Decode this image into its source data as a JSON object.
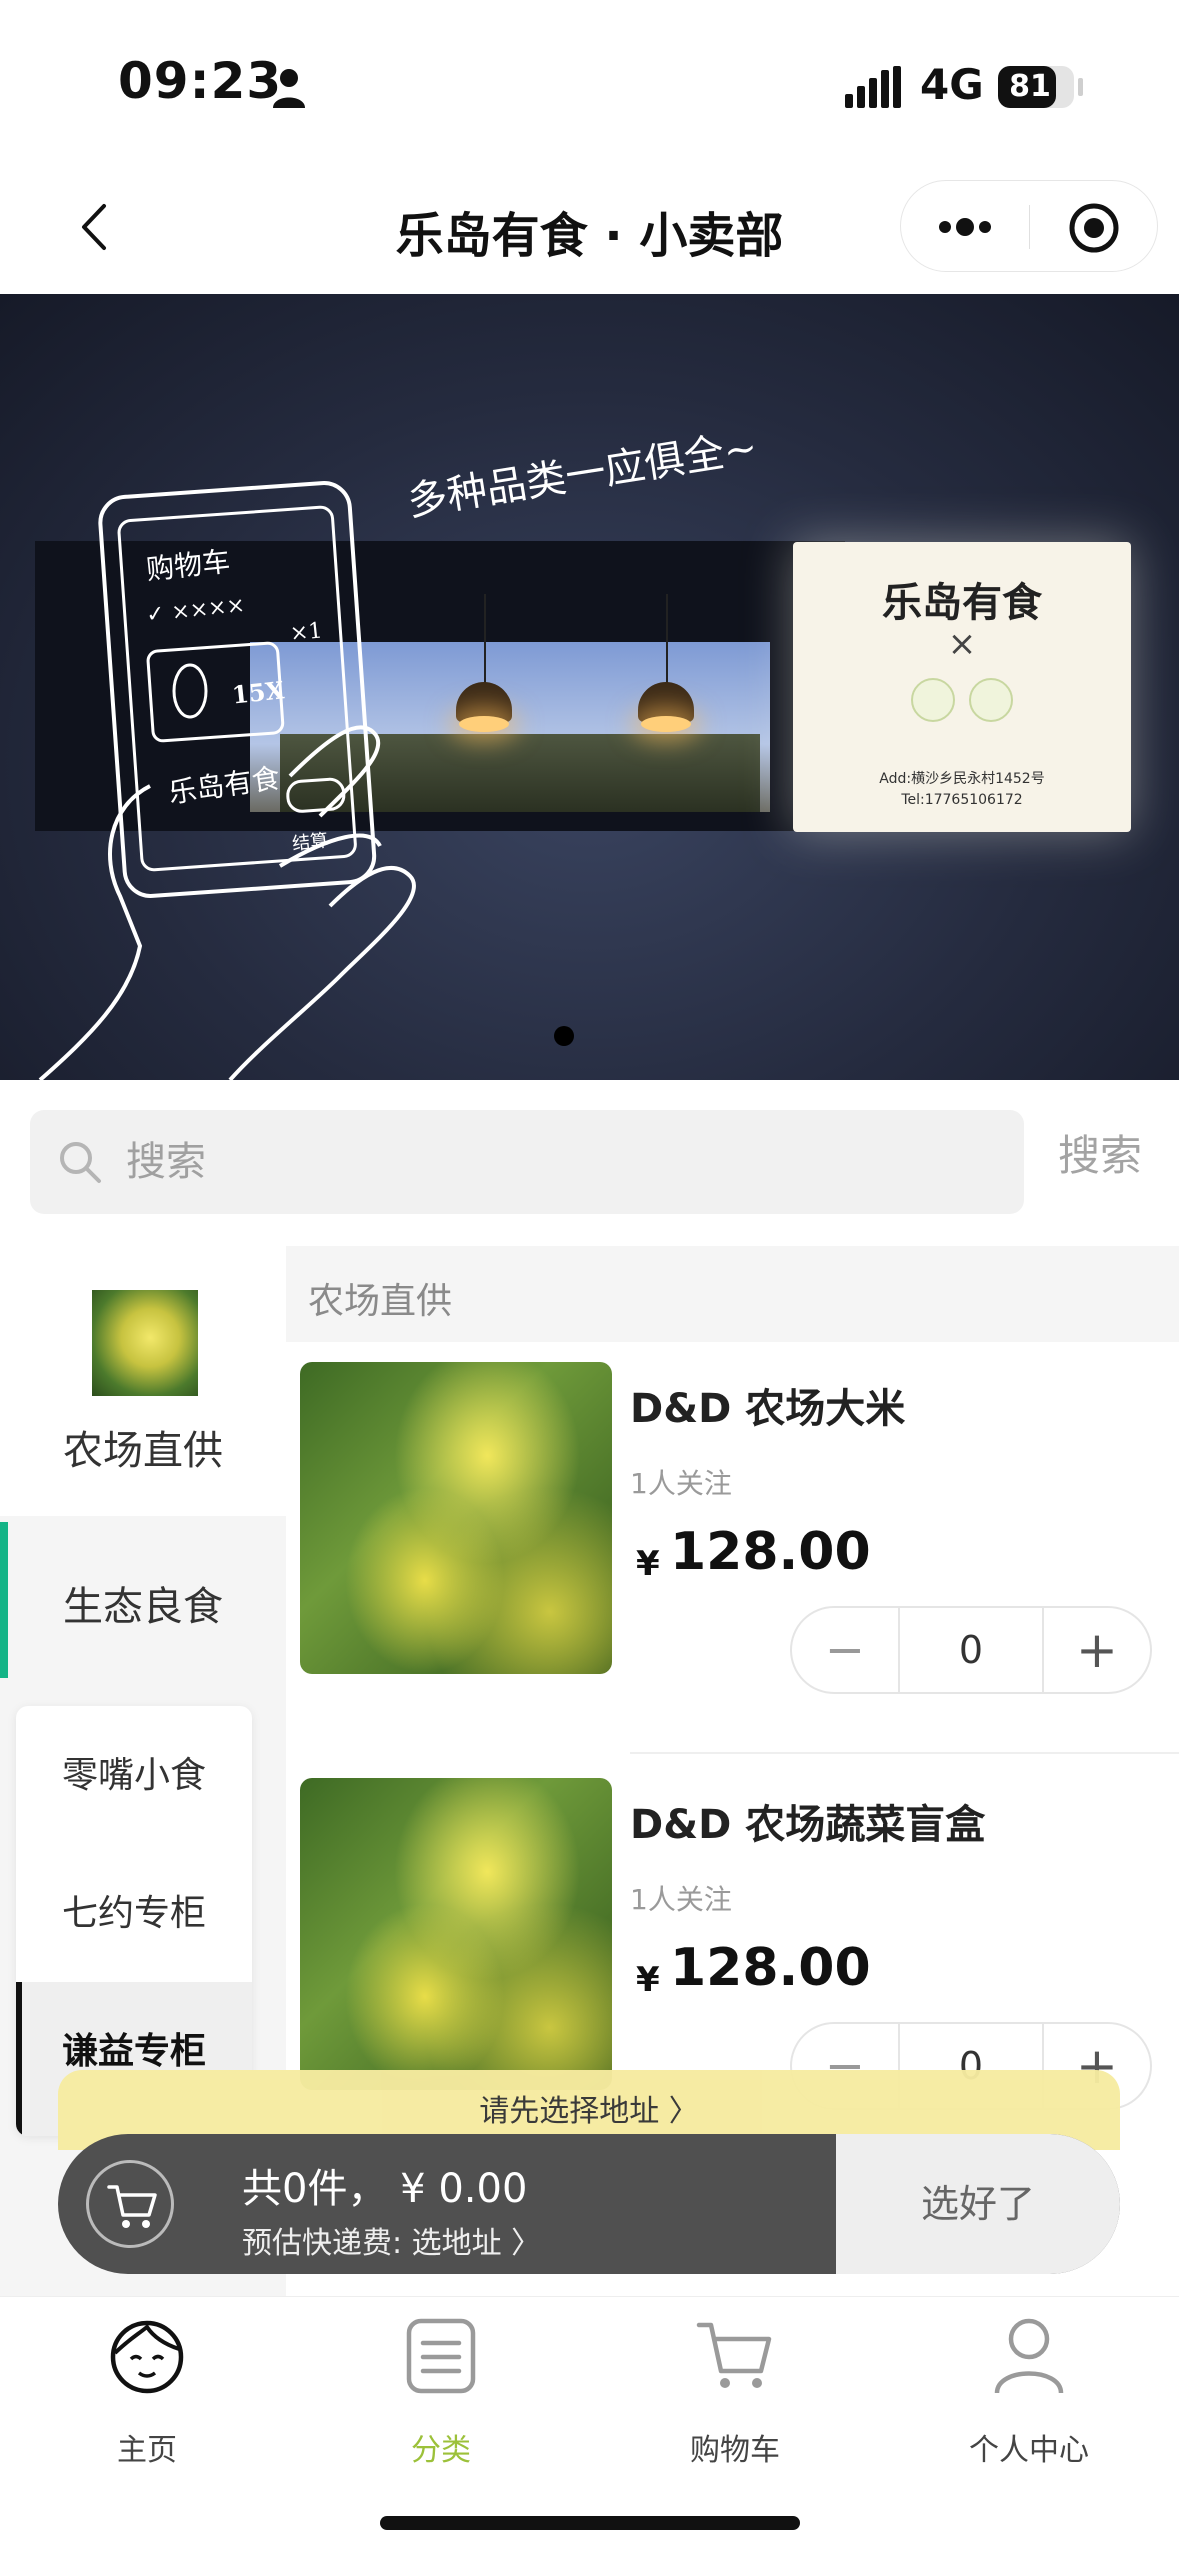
{
  "status_bar": {
    "time": "09:23",
    "network": "4G",
    "battery": "81",
    "battery_level": 0.81
  },
  "nav": {
    "title": "乐岛有食 · 小卖部"
  },
  "banner": {
    "slogan": "多种品类一应俱全~",
    "sign_title": "乐岛有食",
    "sign_x": "×",
    "sign_address": "Add:横沙乡民永村1452号",
    "sign_tel": "Tel:17765106172",
    "sketch_cart": "购物车",
    "sketch_items": "✓ ××××",
    "sketch_qty": "×1",
    "sketch_count": "15X",
    "sketch_store": "乐岛有食",
    "sketch_checkout": "结算"
  },
  "search": {
    "placeholder": "搜索",
    "button": "搜索"
  },
  "sidebar": {
    "categories": [
      {
        "label": "农场直供"
      },
      {
        "label": "生态良食"
      }
    ],
    "sub_items": [
      {
        "label": "零嘴小食"
      },
      {
        "label": "七约专柜"
      },
      {
        "label": "谦益专柜"
      }
    ]
  },
  "section": {
    "title": "农场直供"
  },
  "products": [
    {
      "name": "D&D 农场大米",
      "followers": "1人关注",
      "currency": "¥",
      "price": "128.00",
      "quantity": "0",
      "minus": "−",
      "plus": "+"
    },
    {
      "name": "D&D 农场蔬菜盲盒",
      "followers": "1人关注",
      "currency": "¥",
      "price": "128.00",
      "quantity": "0",
      "minus": "−",
      "plus": "+"
    }
  ],
  "cart": {
    "address_tip": "请先选择地址 〉",
    "summary": "共0件，  ¥ 0.00",
    "shipping": "预估快递费: 选地址 〉",
    "confirm": "选好了"
  },
  "tabs": [
    {
      "label": "主页",
      "icon": "home-face-icon"
    },
    {
      "label": "分类",
      "icon": "category-list-icon",
      "active": true
    },
    {
      "label": "购物车",
      "icon": "cart-icon"
    },
    {
      "label": "个人中心",
      "icon": "user-icon"
    }
  ],
  "colors": {
    "accent_green": "#15b487",
    "tab_active": "#9cc13a",
    "cart_bar": "#505050",
    "address_tip_bg": "#f6eba0"
  }
}
